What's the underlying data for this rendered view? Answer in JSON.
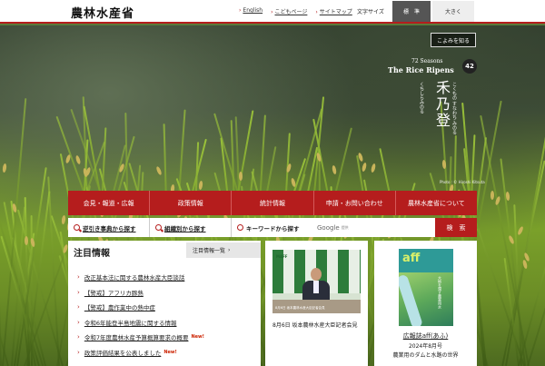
{
  "header": {
    "logo": "農林水産省",
    "links": [
      "English",
      "こどもページ",
      "サイトマップ"
    ],
    "font_size_label": "文字サイズ",
    "font_standard": "標　準",
    "font_large": "大きく"
  },
  "hero": {
    "season_button": "こよみを知る",
    "season_en_top": "72 Seasons",
    "season_en_title": "The Rice Ripens",
    "season_number": "42",
    "season_jp": "禾乃登",
    "season_kana": "こくもの すなわち みのる",
    "season_kana_small": "くちしらみのる",
    "photo_credit": "Photo : © Hiroshi Kitsuta"
  },
  "mainnav": {
    "items": [
      "会見・報道・広報",
      "政策情報",
      "統計情報",
      "申請・お問い合わせ",
      "農林水産省について"
    ]
  },
  "search": {
    "by_item": "逆引き事典から探す",
    "by_org": "組織別から探す",
    "by_keyword": "キーワードから探す",
    "google_label": "Google",
    "google_sub": "提供",
    "button": "検　索"
  },
  "news": {
    "title": "注目情報",
    "all_link": "注目情報一覧",
    "new_badge": "New!",
    "items": [
      {
        "text": "改正基本法に関する農林水産大臣談話",
        "new": false
      },
      {
        "text": "【警戒】アフリカ豚熱",
        "new": false
      },
      {
        "text": "【警戒】農作業中の熱中症",
        "new": false
      },
      {
        "text": "令和6年能登半島地震に関する情報",
        "new": false
      },
      {
        "text": "令和7年度農林水産予算概算要求の概要",
        "new": true
      },
      {
        "text": "政策評価結果を公表しました",
        "new": true
      }
    ]
  },
  "video": {
    "caption": "8月6日 坂本農林水産大臣記者会見",
    "screen_logo": "MAFF",
    "screen_caption": "8月6日 坂本農林水産大臣記者会見"
  },
  "magazine": {
    "cover_logo": "aff",
    "cover_text": "大地を潤す農業用水",
    "title": "広報誌aff(あふ)",
    "issue": "2024年8月号",
    "description": "農業用のダムと水路の世界"
  }
}
